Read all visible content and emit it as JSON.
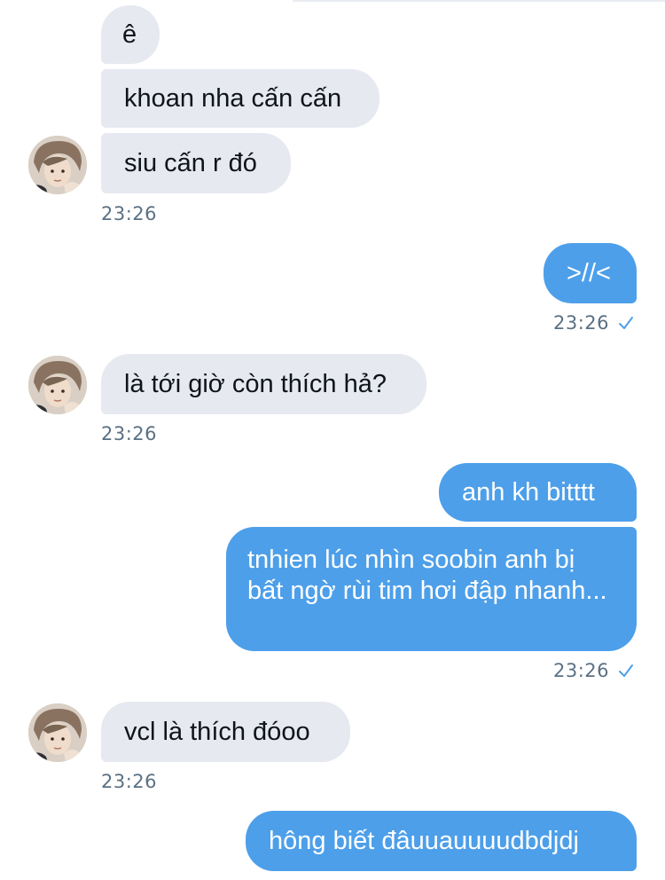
{
  "colors": {
    "incoming_bubble": "#e6e9ef",
    "outgoing_bubble": "#4d9fe9",
    "timestamp": "#5b7083",
    "read_check": "#4d9fe9"
  },
  "messages": [
    {
      "id": "m1",
      "direction": "incoming",
      "text": "ê"
    },
    {
      "id": "m2",
      "direction": "incoming",
      "text": "khoan nha cấn cấn"
    },
    {
      "id": "m3",
      "direction": "incoming",
      "text": "siu cấn r đó"
    },
    {
      "id": "t1",
      "time": "23:26"
    },
    {
      "id": "m4",
      "direction": "outgoing",
      "text": ">//<"
    },
    {
      "id": "t2",
      "time": "23:26",
      "status_icon": "check-icon"
    },
    {
      "id": "m5",
      "direction": "incoming",
      "text": "là tới giờ còn thích hả?"
    },
    {
      "id": "t3",
      "time": "23:26"
    },
    {
      "id": "m6",
      "direction": "outgoing",
      "text": "anh kh bitttt"
    },
    {
      "id": "m7",
      "direction": "outgoing",
      "text": "tnhien lúc nhìn soobin anh bị bất ngờ rùi tim hơi đập nhanh..."
    },
    {
      "id": "t4",
      "time": "23:26",
      "status_icon": "check-icon"
    },
    {
      "id": "m8",
      "direction": "incoming",
      "text": "vcl là thích đóoo"
    },
    {
      "id": "t5",
      "time": "23:26"
    },
    {
      "id": "m9",
      "direction": "outgoing",
      "text": "hông biết đâuuauuuudbdjdj"
    }
  ]
}
